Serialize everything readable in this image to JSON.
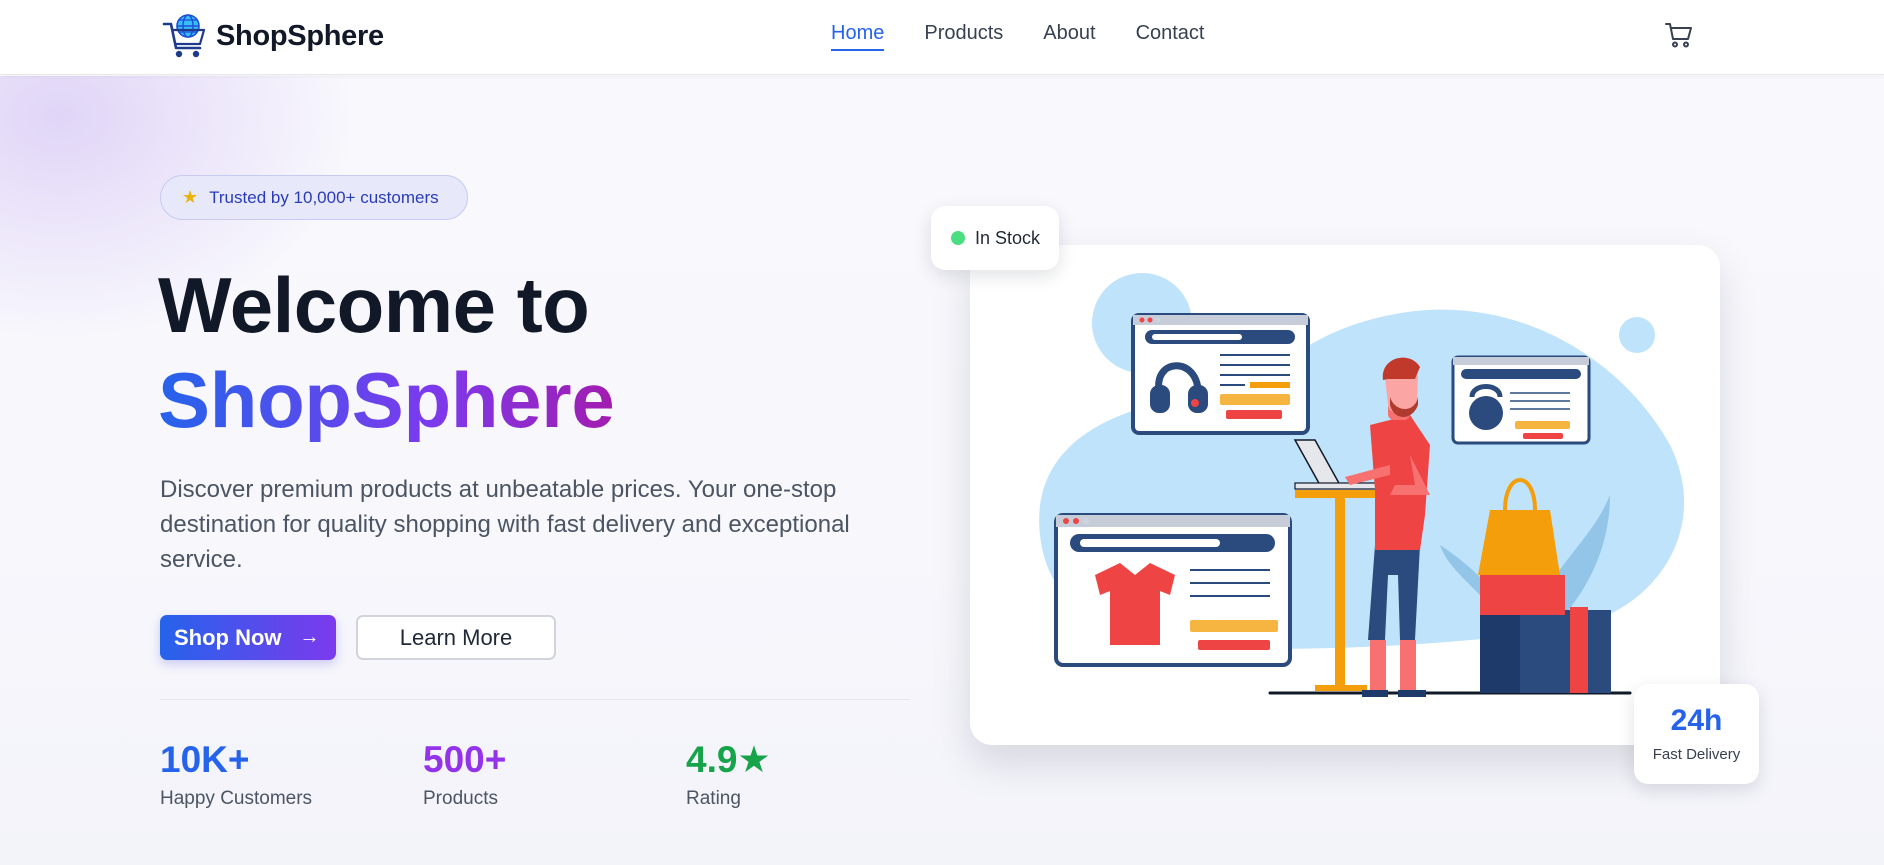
{
  "app": {
    "brand": "ShopSphere"
  },
  "nav": {
    "items": [
      {
        "label": "Home",
        "active": true
      },
      {
        "label": "Products",
        "active": false
      },
      {
        "label": "About",
        "active": false
      },
      {
        "label": "Contact",
        "active": false
      }
    ],
    "cart_icon": "shopping-cart-icon"
  },
  "hero": {
    "badge": {
      "icon": "star-icon",
      "text": "Trusted by 10,000+ customers"
    },
    "title_line1": "Welcome to",
    "title_line2": "ShopSphere",
    "description": "Discover premium products at unbeatable prices. Your one-stop destination for quality shopping with fast delivery and exceptional service.",
    "primary_button": {
      "label": "Shop Now",
      "icon": "arrow-right-icon"
    },
    "secondary_button": {
      "label": "Learn More"
    },
    "stats": [
      {
        "value": "10K+",
        "label": "Happy Customers",
        "color": "#2563eb"
      },
      {
        "value": "500+",
        "label": "Products",
        "color": "#9333ea"
      },
      {
        "value": "4.9★",
        "label": "Rating",
        "color": "#16a34a"
      }
    ],
    "in_stock": {
      "text": "In Stock",
      "color": "#4ade80"
    },
    "delivery": {
      "value": "24h",
      "label": "Fast Delivery"
    }
  },
  "colors": {
    "brand_blue": "#2563eb",
    "brand_purple": "#7c3aed"
  }
}
